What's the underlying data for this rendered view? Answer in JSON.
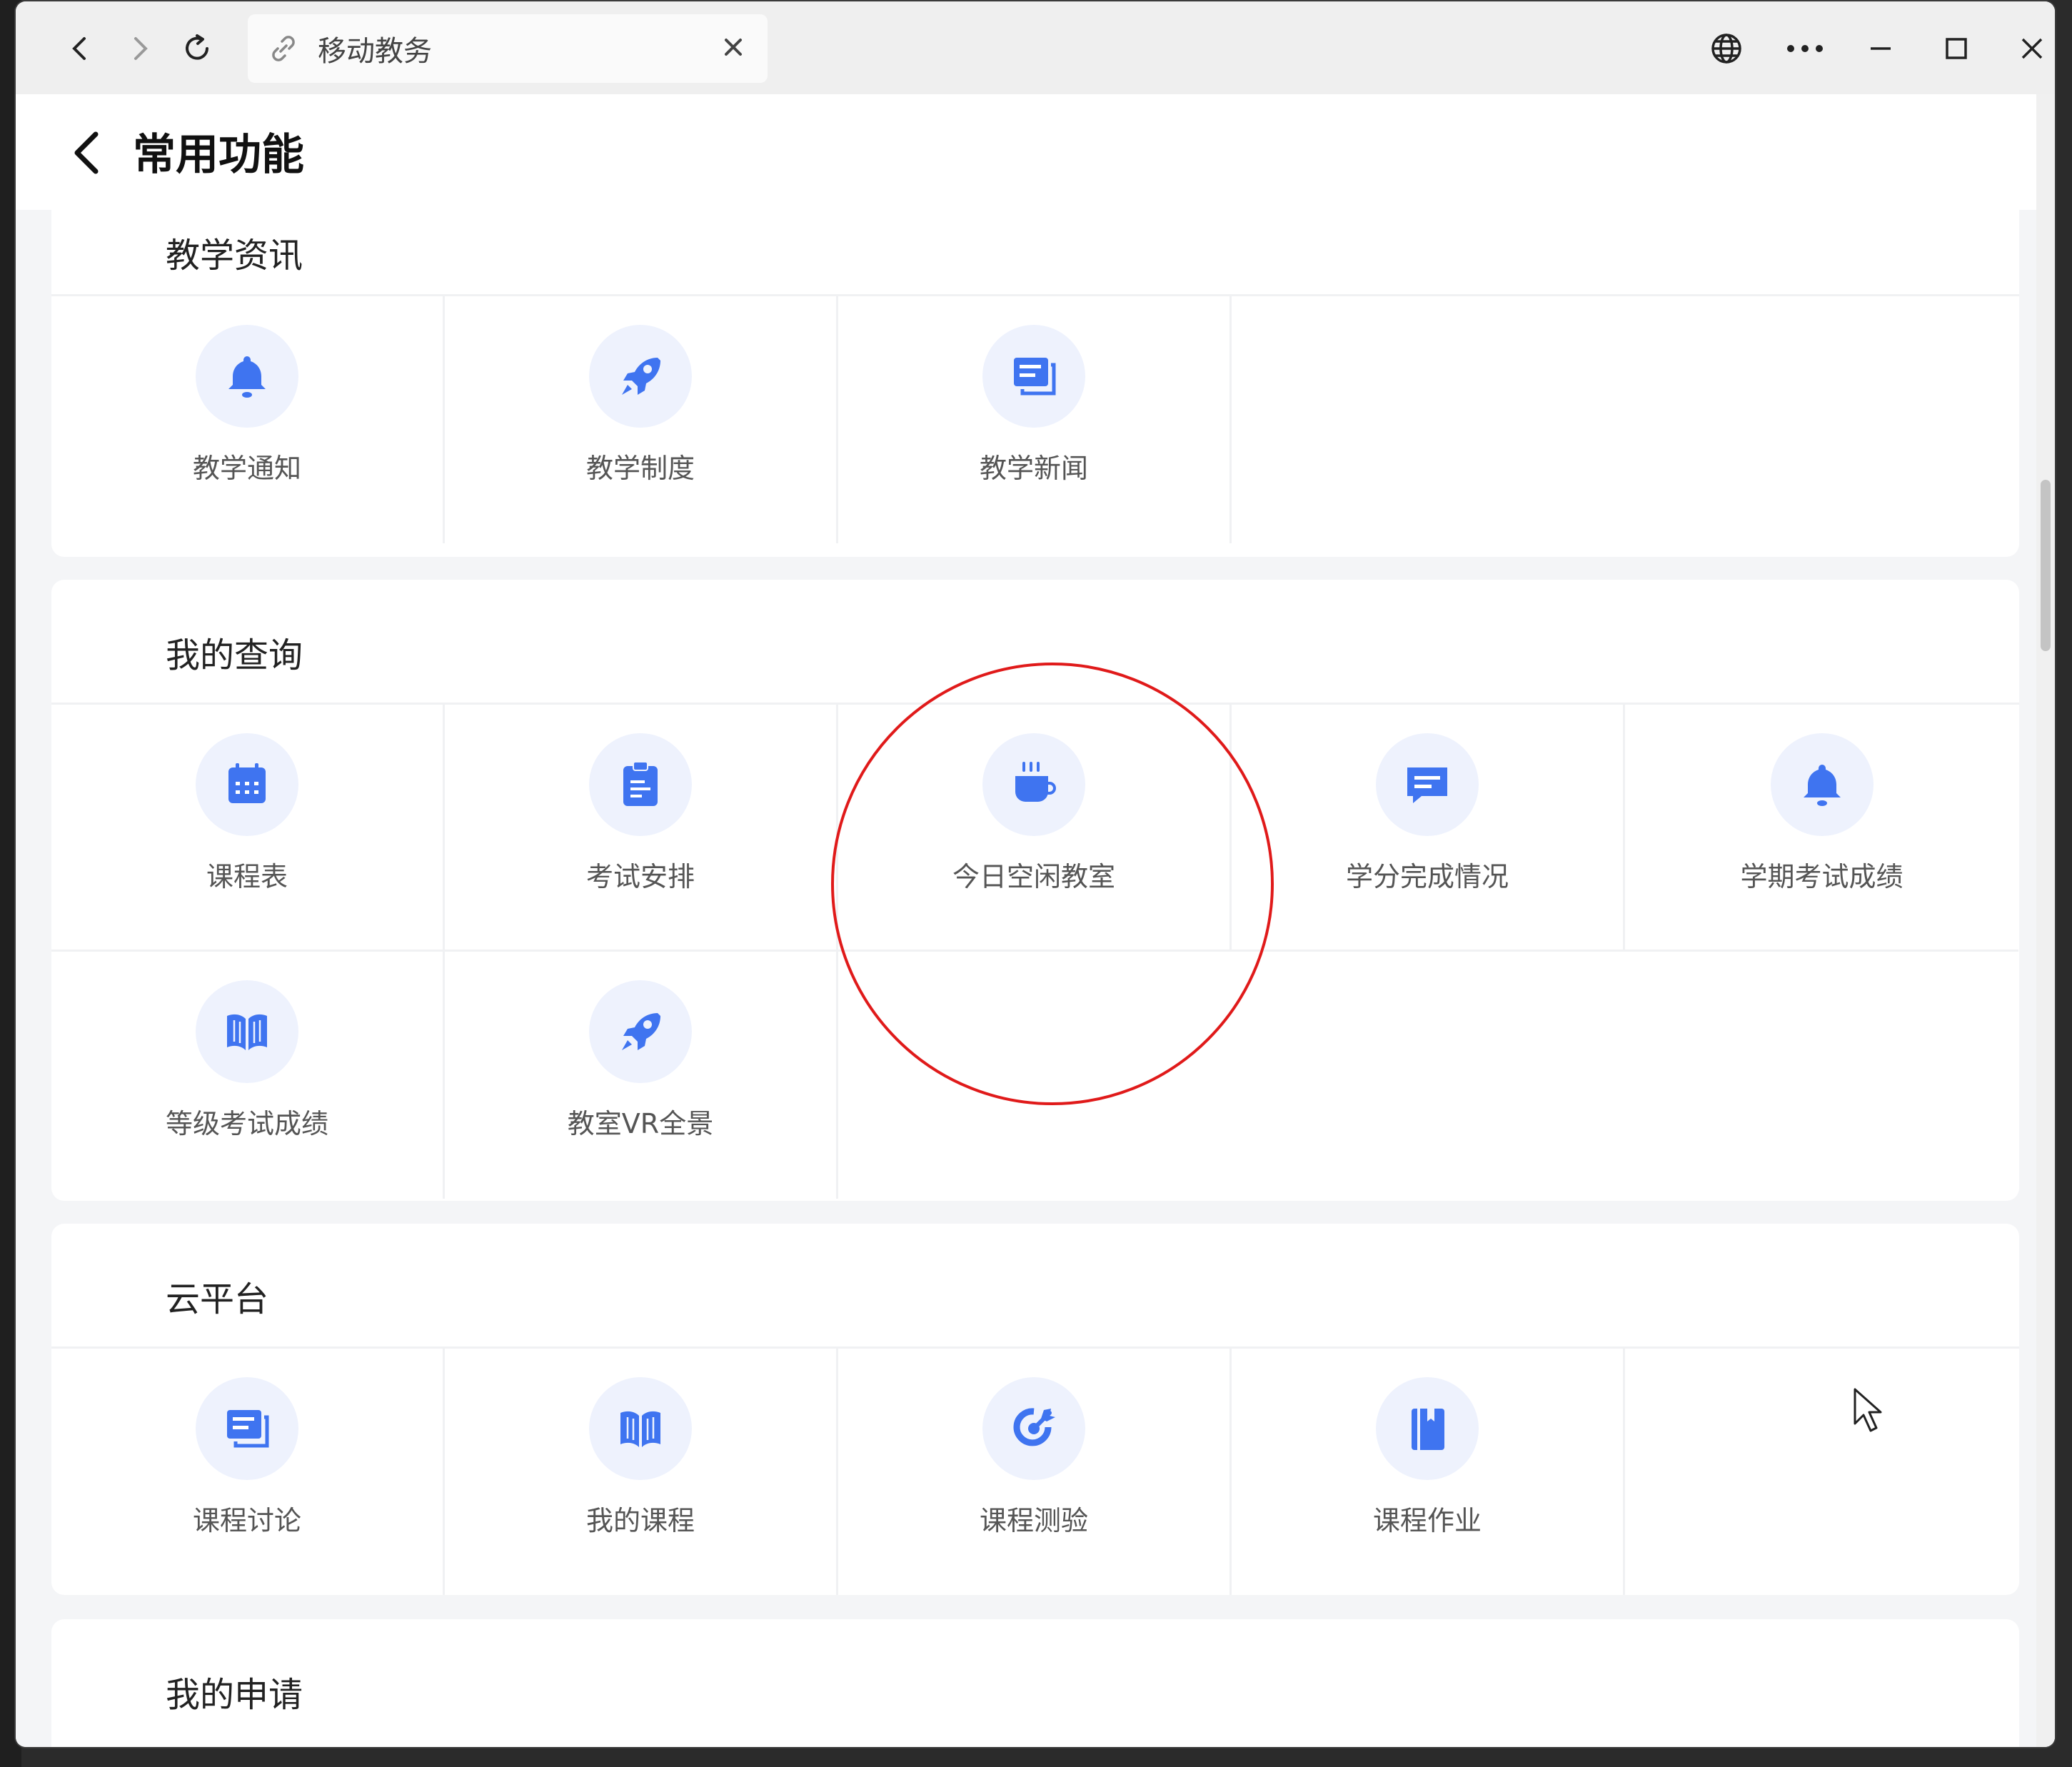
{
  "browser": {
    "tab_title": "移动教务"
  },
  "page": {
    "title": "常用功能"
  },
  "sections": [
    {
      "title": "教学资讯",
      "items": [
        {
          "label": "教学通知",
          "icon": "bell-icon"
        },
        {
          "label": "教学制度",
          "icon": "rocket-icon"
        },
        {
          "label": "教学新闻",
          "icon": "news-icon"
        }
      ]
    },
    {
      "title": "我的查询",
      "items": [
        {
          "label": "课程表",
          "icon": "calendar-icon"
        },
        {
          "label": "考试安排",
          "icon": "clipboard-icon"
        },
        {
          "label": "今日空闲教室",
          "icon": "coffee-cup-icon"
        },
        {
          "label": "学分完成情况",
          "icon": "chat-bubble-icon"
        },
        {
          "label": "学期考试成绩",
          "icon": "bell-icon"
        },
        {
          "label": "等级考试成绩",
          "icon": "open-book-icon"
        },
        {
          "label": "教室VR全景",
          "icon": "rocket-icon"
        }
      ]
    },
    {
      "title": "云平台",
      "items": [
        {
          "label": "课程讨论",
          "icon": "news-icon"
        },
        {
          "label": "我的课程",
          "icon": "open-book-icon"
        },
        {
          "label": "课程测验",
          "icon": "target-icon"
        },
        {
          "label": "课程作业",
          "icon": "notebook-icon"
        }
      ]
    },
    {
      "title": "我的申请",
      "items": []
    }
  ],
  "colors": {
    "accent": "#3f74f0",
    "icon_bg": "#eef2fd",
    "highlight": "#e01a1a"
  }
}
